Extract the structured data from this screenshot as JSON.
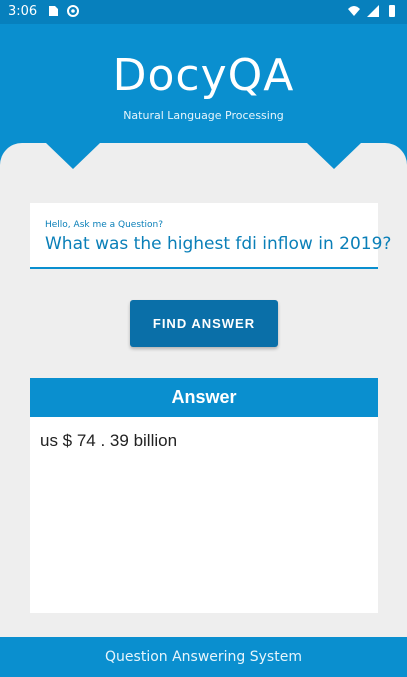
{
  "status_bar": {
    "time": "3:06",
    "icons_left": [
      "sd-card-icon",
      "sync-icon"
    ],
    "icons_right": [
      "wifi-icon",
      "signal-icon",
      "battery-icon"
    ]
  },
  "header": {
    "title": "DocyQA",
    "subtitle": "Natural Language Processing"
  },
  "question": {
    "label": "Hello, Ask me a Question?",
    "value": "What was the highest fdi inflow in 2019?"
  },
  "actions": {
    "find_answer_label": "FIND ANSWER"
  },
  "answer": {
    "heading": "Answer",
    "text": "us $ 74 . 39 billion"
  },
  "footer": {
    "text": "Question Answering System"
  },
  "colors": {
    "primary": "#0a8fcf",
    "button": "#0a6fa8",
    "panel_bg": "#eeeeee"
  }
}
